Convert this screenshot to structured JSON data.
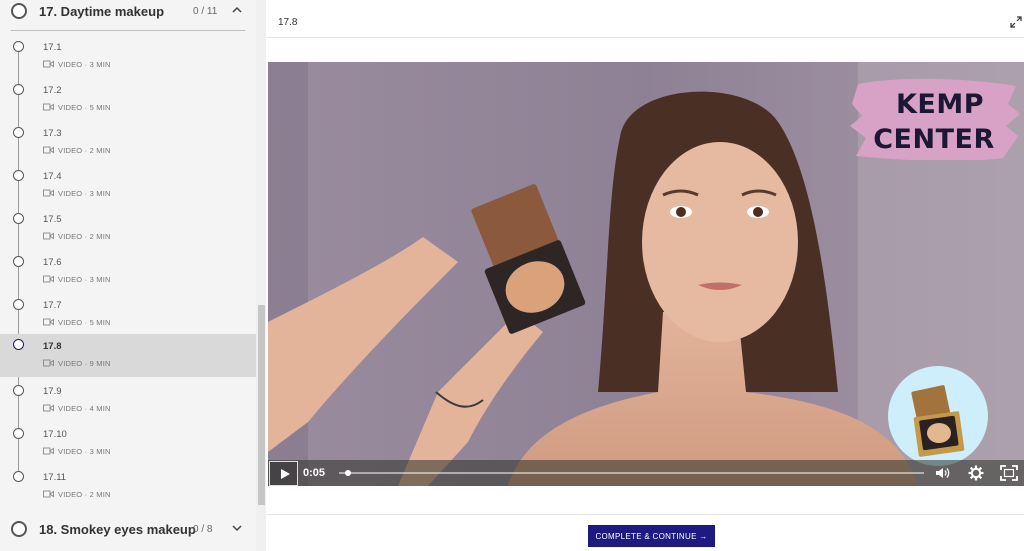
{
  "sidebar": {
    "chapters": [
      {
        "title": "17. Daytime makeup",
        "count": "0 / 11",
        "expanded": true
      },
      {
        "title": "18. Smokey eyes makeup",
        "count": "0 / 8",
        "expanded": false
      }
    ],
    "lessons": [
      {
        "number": "17.1",
        "meta": "VIDEO · 3 MIN",
        "active": false
      },
      {
        "number": "17.2",
        "meta": "VIDEO · 5 MIN",
        "active": false
      },
      {
        "number": "17.3",
        "meta": "VIDEO · 2 MIN",
        "active": false
      },
      {
        "number": "17.4",
        "meta": "VIDEO · 3 MIN",
        "active": false
      },
      {
        "number": "17.5",
        "meta": "VIDEO · 2 MIN",
        "active": false
      },
      {
        "number": "17.6",
        "meta": "VIDEO · 3 MIN",
        "active": false
      },
      {
        "number": "17.7",
        "meta": "VIDEO · 5 MIN",
        "active": false
      },
      {
        "number": "17.8",
        "meta": "VIDEO · 9 MIN",
        "active": true
      },
      {
        "number": "17.9",
        "meta": "VIDEO · 4 MIN",
        "active": false
      },
      {
        "number": "17.10",
        "meta": "VIDEO · 3 MIN",
        "active": false
      },
      {
        "number": "17.11",
        "meta": "VIDEO · 2 MIN",
        "active": false
      }
    ]
  },
  "main": {
    "lesson_title": "17.8",
    "video": {
      "brand_line1": "KEMP",
      "brand_line2": "CENTER",
      "time": "0:05",
      "progress": 0.01
    },
    "complete_button": "COMPLETE & CONTINUE →"
  },
  "colors": {
    "accent": "#1d1a80",
    "brand_brush": "#d7a2c6",
    "active_lesson_bg": "#d9d9d9"
  },
  "icons": [
    "chevron-up-icon",
    "chevron-down-icon",
    "video-camera-icon",
    "expand-icon",
    "play-icon",
    "volume-icon",
    "settings-gear-icon",
    "fullscreen-icon"
  ]
}
